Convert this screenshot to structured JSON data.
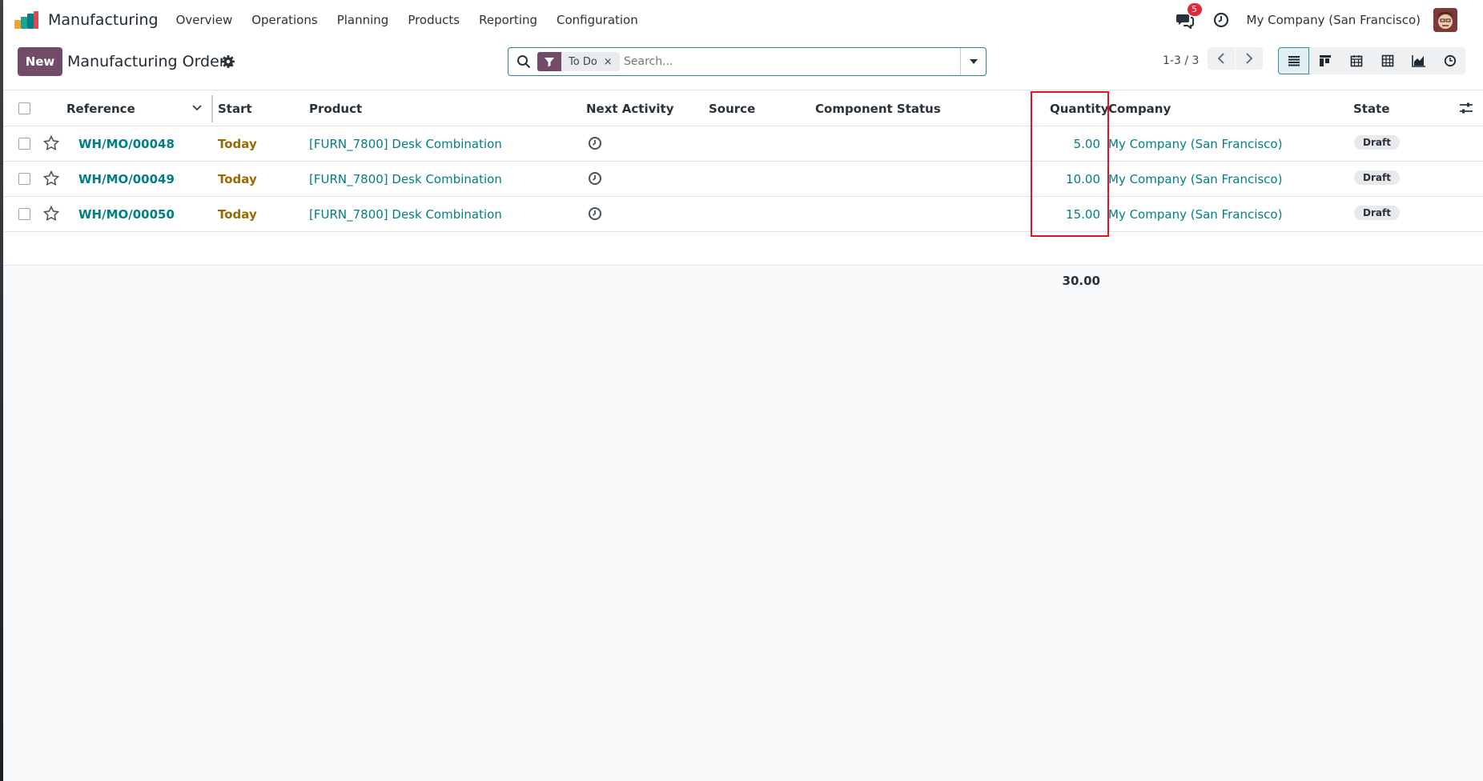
{
  "navbar": {
    "app_name": "Manufacturing",
    "menu": [
      "Overview",
      "Operations",
      "Planning",
      "Products",
      "Reporting",
      "Configuration"
    ],
    "messages_badge": "5",
    "company": "My Company (San Francisco)"
  },
  "control": {
    "new_label": "New",
    "title": "Manufacturing Orders",
    "search": {
      "facet_label": "To Do",
      "facet_close": "×",
      "placeholder": "Search..."
    },
    "pager": "1-3 / 3"
  },
  "list": {
    "columns": [
      "Reference",
      "Start",
      "Product",
      "Next Activity",
      "Source",
      "Component Status",
      "Quantity",
      "Company",
      "State"
    ],
    "rows": [
      {
        "reference": "WH/MO/00048",
        "start": "Today",
        "product": "[FURN_7800] Desk Combination",
        "quantity": "5.00",
        "company": "My Company (San Francisco)",
        "state": "Draft"
      },
      {
        "reference": "WH/MO/00049",
        "start": "Today",
        "product": "[FURN_7800] Desk Combination",
        "quantity": "10.00",
        "company": "My Company (San Francisco)",
        "state": "Draft"
      },
      {
        "reference": "WH/MO/00050",
        "start": "Today",
        "product": "[FURN_7800] Desk Combination",
        "quantity": "15.00",
        "company": "My Company (San Francisco)",
        "state": "Draft"
      }
    ],
    "total_quantity": "30.00"
  },
  "colors": {
    "brand": "#714b67",
    "link": "#017e84",
    "today": "#9a6a00",
    "highlight": "#e3141f"
  }
}
